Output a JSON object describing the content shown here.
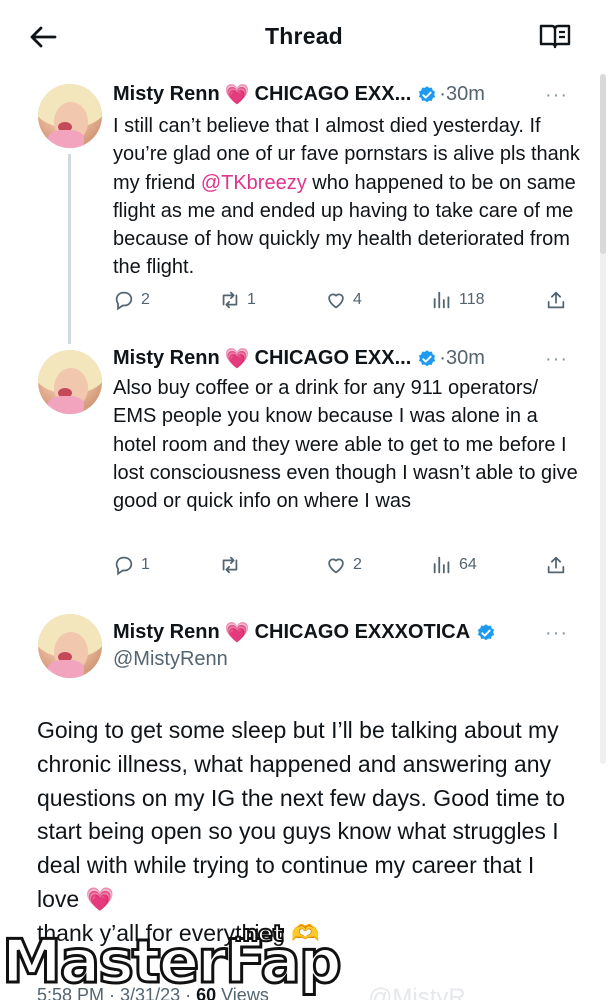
{
  "header": {
    "title": "Thread",
    "back_icon": "arrow-left-icon",
    "reader_icon": "book-icon"
  },
  "tweets": [
    {
      "name": "Misty Renn",
      "heart": "💗",
      "name_suffix": "CHICAGO EXX...",
      "time": "·30m",
      "more": "···",
      "text_before": "I still can’t believe that I almost died yesterday. If you’re glad one of ur fave pornstars is alive pls thank my friend ",
      "mention": "@TKbreezy",
      "text_after": " who happened to be on same flight as me and ended up having to take care of me because of how quickly my health deteriorated from the flight.",
      "replies": "2",
      "retweets": "1",
      "likes": "4",
      "views": "118"
    },
    {
      "name": "Misty Renn",
      "heart": "💗",
      "name_suffix": "CHICAGO EXX...",
      "time": "·30m",
      "more": "···",
      "text": "Also buy coffee or a drink for any 911 operators/ EMS people you know because I was alone in a hotel room and they were able to get to me before I lost consciousness even though I wasn’t able to give good or quick info on where I was",
      "replies": "1",
      "retweets": "",
      "likes": "2",
      "views": "64"
    }
  ],
  "main_tweet": {
    "name": "Misty Renn",
    "heart": "💗",
    "name_suffix": "CHICAGO EXXXOTICA",
    "handle": "@MistyRenn",
    "more": "···",
    "text": "Going to get some sleep but I’ll be talking about my chronic illness, what happened and answering any questions on my IG the next few days. Good time to start being open so you guys know what struggles I deal with while trying to continue my career that I love",
    "heart_end": "💗",
    "last_line": "thank y’all for everything",
    "hands": "🫶",
    "meta_time": "5:58 PM · 3/31/23 · ",
    "meta_views_count": "60",
    "meta_views_label": " Views",
    "ghost_handle": "@MistyR..."
  },
  "watermark": {
    "text": "MasterFap",
    "tld": ".net"
  },
  "colors": {
    "accent": "#e0338c",
    "verified": "#1d9bf0",
    "muted": "#536471",
    "text": "#0f1419"
  }
}
